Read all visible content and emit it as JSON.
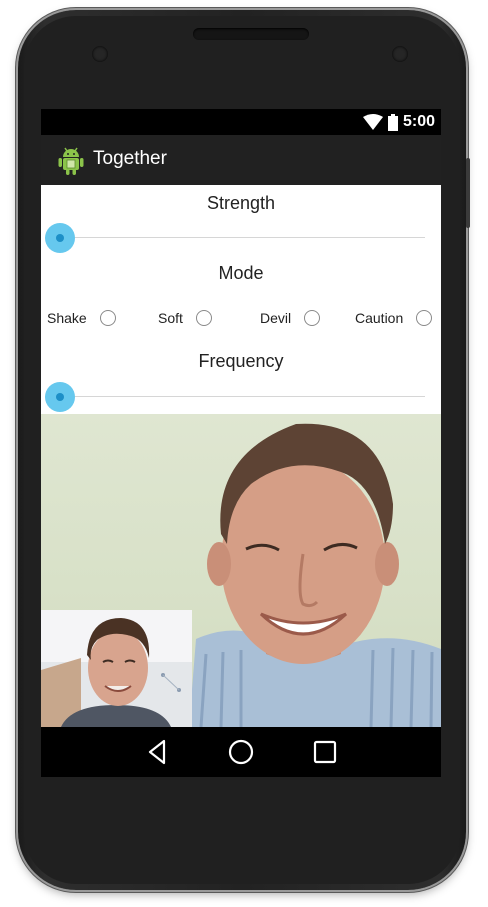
{
  "status_bar": {
    "time": "5:00",
    "icons": [
      "wifi-icon",
      "battery-icon"
    ]
  },
  "action_bar": {
    "app_icon": "android-icon",
    "title": "Together"
  },
  "controls": {
    "strength": {
      "label": "Strength",
      "value": 0
    },
    "mode": {
      "label": "Mode",
      "options": [
        {
          "label": "Shake",
          "selected": false
        },
        {
          "label": "Soft",
          "selected": false
        },
        {
          "label": "Devil",
          "selected": false
        },
        {
          "label": "Caution",
          "selected": false
        }
      ]
    },
    "frequency": {
      "label": "Frequency",
      "value": 0
    }
  },
  "video": {
    "remote": "remote-participant-video",
    "local": "self-view-video"
  },
  "nav_bar": {
    "buttons": [
      "back-icon",
      "home-icon",
      "recents-icon"
    ]
  },
  "colors": {
    "accent": "#66c8ee",
    "accent_dark": "#1d8fc7",
    "action_bar": "#212121"
  }
}
